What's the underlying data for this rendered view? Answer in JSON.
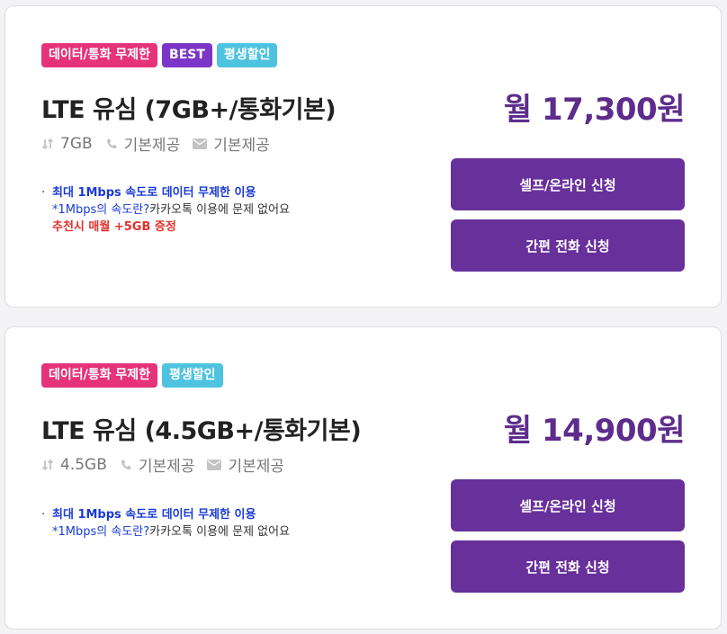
{
  "plans": [
    {
      "badges": [
        "데이터/통화 무제한",
        "BEST",
        "평생할인"
      ],
      "title": "LTE 유심 (7GB+/통화기본)",
      "price": "월 17,300원",
      "specs": {
        "data": "7GB",
        "voice": "기본제공",
        "sms": "기본제공"
      },
      "notes": {
        "line1": "최대 1Mbps 속도로 데이터 무제한 이용",
        "line2_link": "*1Mbps의 속도란?",
        "line2_text": " 카카오톡 이용에 문제 없어요",
        "promo": "추천시 매월 +5GB 증정"
      },
      "buttons": {
        "self": "셀프/온라인 신청",
        "phone": "간편 전화 신청"
      }
    },
    {
      "badges": [
        "데이터/통화 무제한",
        "평생할인"
      ],
      "title": "LTE 유심 (4.5GB+/통화기본)",
      "price": "월 14,900원",
      "specs": {
        "data": "4.5GB",
        "voice": "기본제공",
        "sms": "기본제공"
      },
      "notes": {
        "line1": "최대 1Mbps 속도로 데이터 무제한 이용",
        "line2_link": "*1Mbps의 속도란?",
        "line2_text": " 카카오톡 이용에 문제 없어요"
      },
      "buttons": {
        "self": "셀프/온라인 신청",
        "phone": "간편 전화 신청"
      }
    }
  ],
  "icons": {
    "data": "data-arrows-icon",
    "voice": "phone-icon",
    "sms": "mail-icon"
  },
  "colors": {
    "badge_unlimited": "#e6327a",
    "badge_best": "#7b35c8",
    "badge_discount": "#4ec3e0",
    "price": "#5e2c8c",
    "button": "#68309a",
    "note_blue": "#1a3bd4",
    "note_red": "#e5302c"
  }
}
